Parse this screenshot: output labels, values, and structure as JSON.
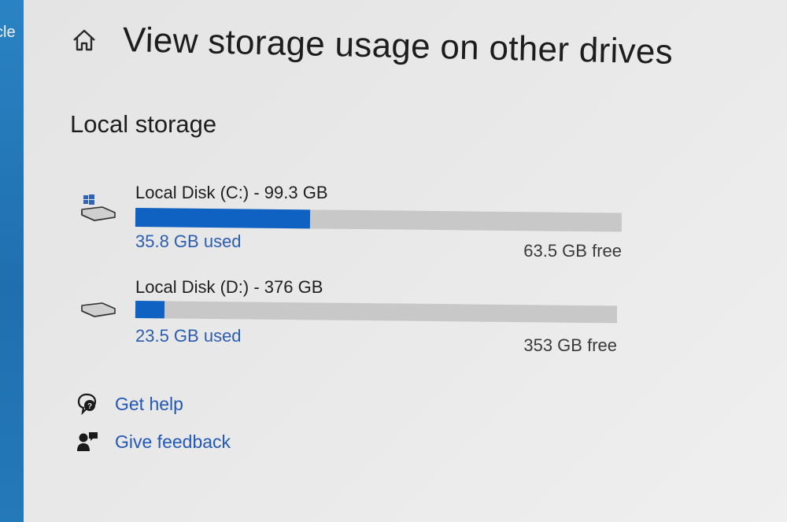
{
  "window": {
    "left_edge_text": "cle"
  },
  "header": {
    "home_icon": "home-icon",
    "title": "View storage usage on other drives"
  },
  "local_storage": {
    "section_title": "Local storage",
    "drives": [
      {
        "icon": "windows-drive-icon",
        "label": "Local Disk (C:) - 99.3 GB",
        "used_label": "35.8 GB used",
        "free_label": "63.5 GB free",
        "used_fraction": 0.36
      },
      {
        "icon": "drive-icon",
        "label": "Local Disk (D:) - 376 GB",
        "used_label": "23.5 GB used",
        "free_label": "353 GB free",
        "used_fraction": 0.06
      }
    ]
  },
  "links": {
    "get_help": {
      "label": "Get help",
      "icon": "help-chat-icon"
    },
    "give_feedback": {
      "label": "Give feedback",
      "icon": "feedback-icon"
    }
  },
  "colors": {
    "accent": "#0f62c2",
    "link": "#2358b5",
    "bar_track": "#c8c8c8",
    "left_strip": "#2479b8"
  }
}
